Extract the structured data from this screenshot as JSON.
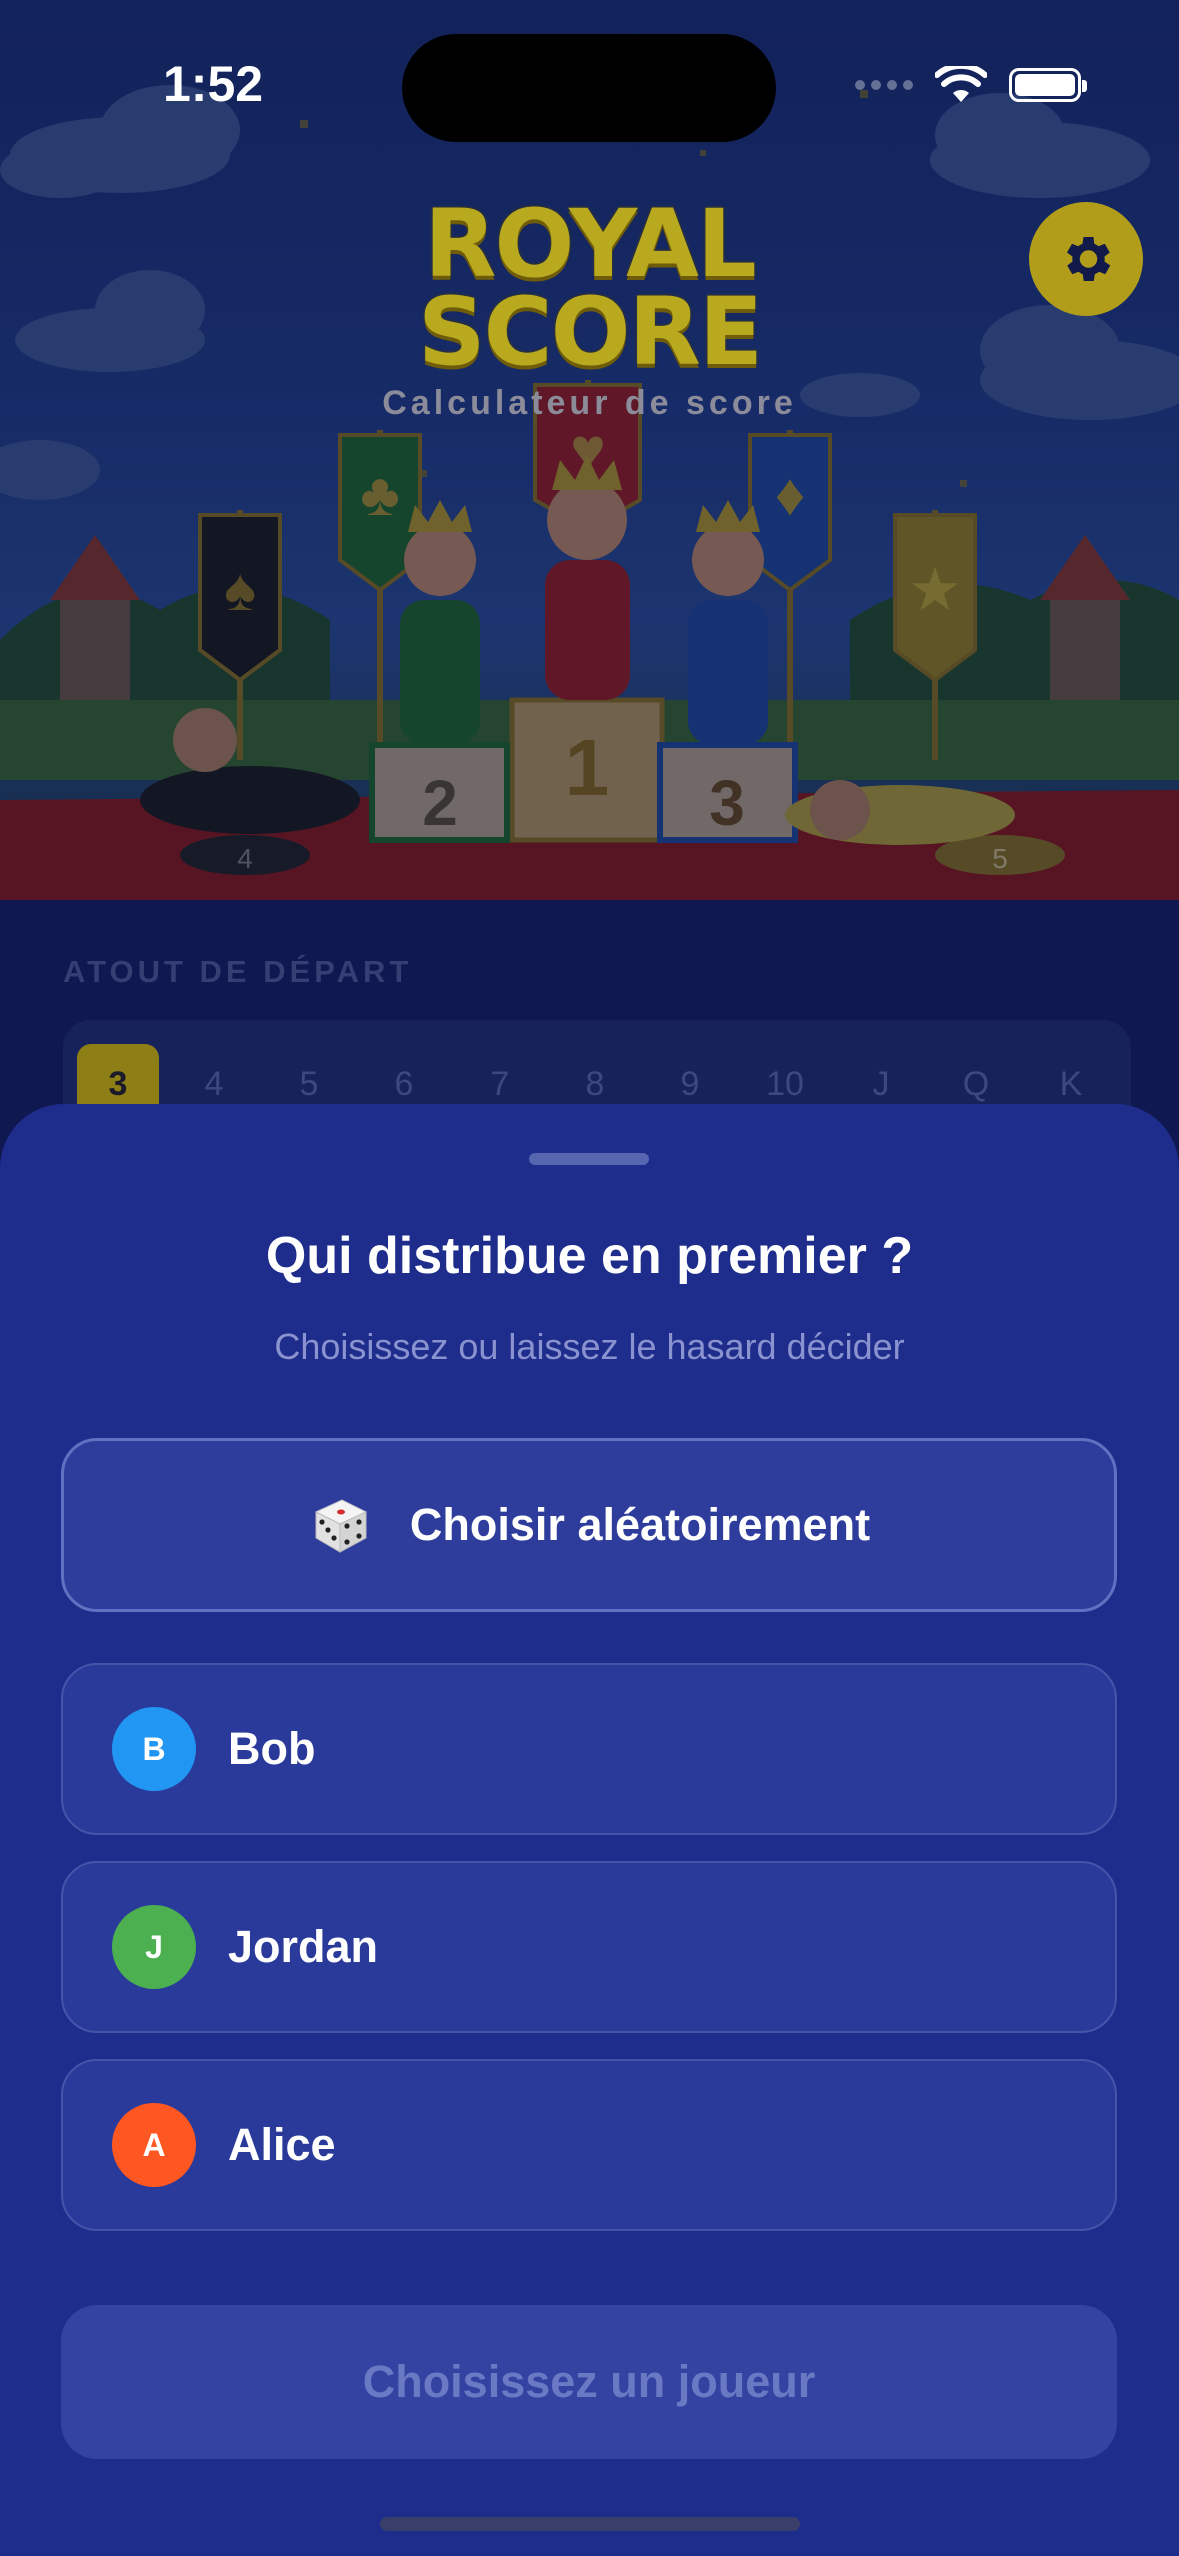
{
  "status_bar": {
    "time": "1:52"
  },
  "header": {
    "logo_line1": "ROYAL",
    "logo_line2": "SCORE",
    "subtitle": "Calculateur de score",
    "podium_places": [
      "1",
      "2",
      "3",
      "4",
      "5"
    ]
  },
  "background": {
    "atout_label": "ATOUT DE DÉPART",
    "atout_values": [
      "3",
      "4",
      "5",
      "6",
      "7",
      "8",
      "9",
      "10",
      "J",
      "Q",
      "K"
    ],
    "atout_selected": "3"
  },
  "sheet": {
    "title": "Qui distribue en premier ?",
    "subtitle": "Choisissez ou laissez le hasard décider",
    "random_button_label": "Choisir aléatoirement",
    "players": [
      {
        "initial": "B",
        "name": "Bob",
        "color": "#2196f3"
      },
      {
        "initial": "J",
        "name": "Jordan",
        "color": "#4caf50"
      },
      {
        "initial": "A",
        "name": "Alice",
        "color": "#ff5722"
      }
    ],
    "confirm_button_label": "Choisissez un joueur"
  },
  "colors": {
    "sheet_bg": "#1e2d8c",
    "accent_gold": "#b9a91f"
  }
}
